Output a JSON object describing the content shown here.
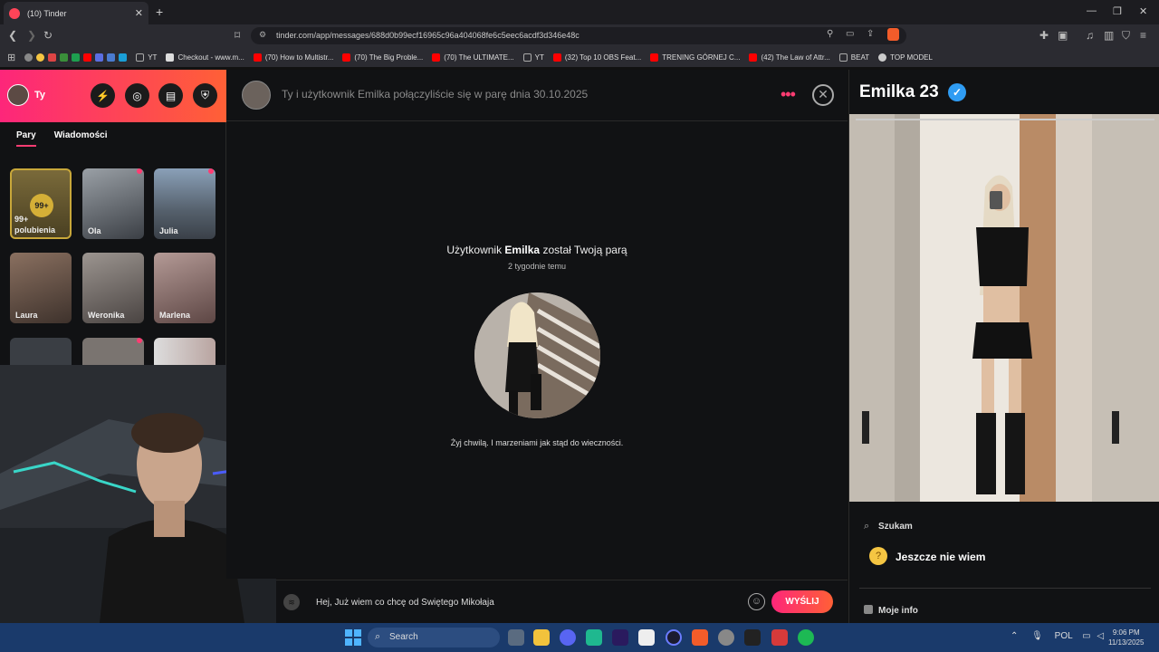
{
  "browser": {
    "tab_title": "(10) Tinder",
    "url": "tinder.com/app/messages/688d0b99ecf16965c96a404068fe6c5eec6acdf3d346e48c",
    "bookmarks": [
      {
        "label": "YT",
        "color": "#aaaaaa"
      },
      {
        "label": "Checkout - www.m...",
        "color": "#dddddd"
      },
      {
        "label": "(70) How to Multistr...",
        "color": "#ff0000"
      },
      {
        "label": "(70) The Big Proble...",
        "color": "#ff0000"
      },
      {
        "label": "(70) The ULTIMATE...",
        "color": "#ff0000"
      },
      {
        "label": "YT",
        "color": "#aaaaaa"
      },
      {
        "label": "(32) Top 10 OBS Feat...",
        "color": "#ff0000"
      },
      {
        "label": "TRENING GÓRNEJ C...",
        "color": "#ff0000"
      },
      {
        "label": "(42) The Law of Attr...",
        "color": "#ff0000"
      },
      {
        "label": "BEAT",
        "color": "#aaaaaa"
      },
      {
        "label": "TOP MODEL",
        "color": "#cccccc"
      }
    ]
  },
  "sidebar": {
    "user_label": "Ty",
    "tabs": [
      "Pary",
      "Wiadomości"
    ],
    "likes_badge": "99+",
    "likes_label": "99+ polubienia",
    "matches": [
      "Ola",
      "Julia",
      "Laura",
      "Weronika",
      "Marlena"
    ]
  },
  "chat": {
    "match_info": "Ty i użytkownik Emilka połączyliście się w parę dnia 30.10.2025",
    "match_title_prefix": "Użytkownik ",
    "match_name": "Emilka",
    "match_title_suffix": " został Twoją parą",
    "match_time": "2 tygodnie temu",
    "bio": "Żyj chwilą. I marzeniami jak stąd do wieczności.",
    "message_value": "Hej, Już wiem co chcę od Świętego Mikołaja",
    "send_label": "WYŚLIJ"
  },
  "profile": {
    "name": "Emilka 23",
    "looking_label": "Szukam",
    "looking_value": "Jeszcze nie wiem",
    "info_label": "Moje info"
  },
  "taskbar": {
    "search_placeholder": "Search",
    "lang": "POL",
    "time": "9:06 PM",
    "date": "11/13/2025"
  },
  "colors": {
    "accent": "#fe3c72",
    "gradient_start": "#fd267a",
    "gradient_end": "#ff6036",
    "verified": "#2f9cf3"
  }
}
